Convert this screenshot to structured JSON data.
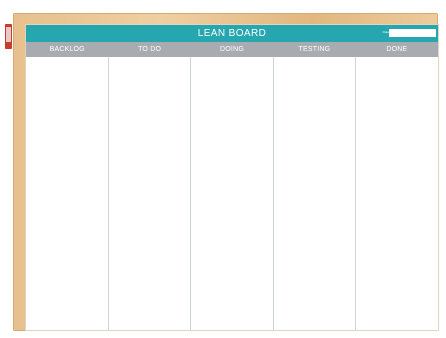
{
  "board": {
    "title": "LEAN BOARD",
    "date_label": "Date",
    "columns": [
      "BACKLOG",
      "TO DO",
      "DOING",
      "TESTING",
      "DONE"
    ]
  },
  "colors": {
    "header_teal": "#26a6ae",
    "column_gray": "#a8abaf",
    "frame_wood": "#e7c08d",
    "tag_red": "#c63b2c"
  }
}
